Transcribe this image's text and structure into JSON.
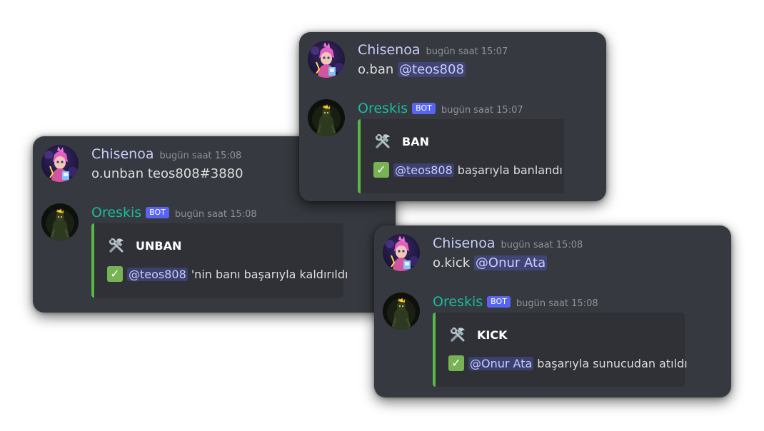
{
  "ban_panel": {
    "user_msg": {
      "username": "Chisenoa",
      "timestamp": "bugün saat 15:07",
      "command": "o.ban",
      "mention": "@teos808"
    },
    "bot_msg": {
      "username": "Oreskis",
      "bot_tag": "BOT",
      "timestamp": "bugün saat 15:07",
      "embed_title": "BAN",
      "embed_mention": "@teos808",
      "embed_text": "başarıyla banlandı"
    }
  },
  "unban_panel": {
    "user_msg": {
      "username": "Chisenoa",
      "timestamp": "bugün saat 15:08",
      "command": "o.unban teos808#3880"
    },
    "bot_msg": {
      "username": "Oreskis",
      "bot_tag": "BOT",
      "timestamp": "bugün saat 15:08",
      "embed_title": "UNBAN",
      "embed_mention": "@teos808",
      "embed_text": "'nin banı başarıyla kaldırıldı"
    }
  },
  "kick_panel": {
    "user_msg": {
      "username": "Chisenoa",
      "timestamp": "bugün saat 15:08",
      "command": "o.kick",
      "mention": "@Onur Ata"
    },
    "bot_msg": {
      "username": "Oreskis",
      "bot_tag": "BOT",
      "timestamp": "bugün saat 15:08",
      "embed_title": "KICK",
      "embed_mention": "@Onur Ata",
      "embed_text": "başarıyla sunucudan atıldı"
    }
  },
  "colors": {
    "background": "#36393f",
    "embed_background": "#2f3136",
    "embed_accent": "#57b846",
    "user_name": "#c9cdfb",
    "bot_name": "#1abc9c",
    "bot_tag": "#5865f2",
    "timestamp": "#8e9297",
    "mention": "#c9cdfb"
  },
  "icons": {
    "embed_title_icon": "hammer-and-wrench-icon",
    "embed_status_icon": "check-mark-icon"
  }
}
